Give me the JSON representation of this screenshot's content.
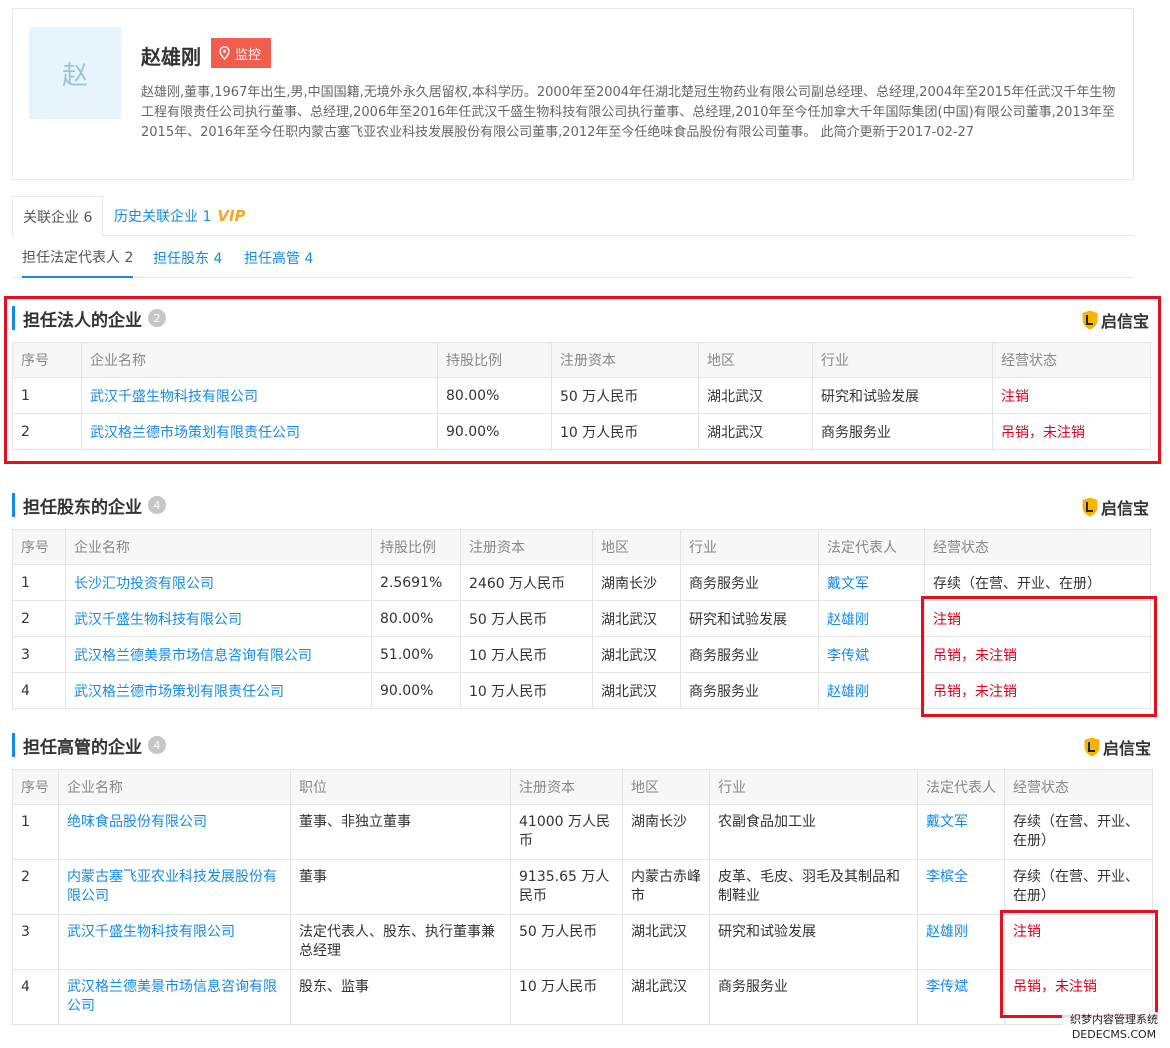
{
  "profile": {
    "avatar_char": "赵",
    "name": "赵雄刚",
    "monitor_label": "监控",
    "bio": "赵雄刚,董事,1967年出生,男,中国国籍,无境外永久居留权,本科学历。2000年至2004年任湖北楚冠生物药业有限公司副总经理、总经理,2004年至2015年任武汉千年生物工程有限责任公司执行董事、总经理,2006年至2016年任武汉千盛生物科技有限公司执行董事、总经理,2010年至今任加拿大千年国际集团(中国)有限公司董事,2013年至2015年、2016年至今任职内蒙古塞飞亚农业科技发展股份有限公司董事,2012年至今任绝味食品股份有限公司董事。 此简介更新于2017-02-27"
  },
  "tabs": {
    "related": "关联企业 6",
    "history": "历史关联企业 1",
    "vip": "VIP"
  },
  "subtabs": [
    "担任法定代表人 2",
    "担任股东 4",
    "担任高管 4"
  ],
  "brand": "启信宝",
  "legal": {
    "title": "担任法人的企业",
    "count": "2",
    "headers": [
      "序号",
      "企业名称",
      "持股比例",
      "注册资本",
      "地区",
      "行业",
      "经营状态"
    ],
    "rows": [
      [
        "1",
        "武汉千盛生物科技有限公司",
        "80.00%",
        "50 万人民币",
        "湖北武汉",
        "研究和试验发展",
        "注销"
      ],
      [
        "2",
        "武汉格兰德市场策划有限责任公司",
        "90.00%",
        "10 万人民币",
        "湖北武汉",
        "商务服务业",
        "吊销，未注销"
      ]
    ]
  },
  "shareholder": {
    "title": "担任股东的企业",
    "count": "4",
    "headers": [
      "序号",
      "企业名称",
      "持股比例",
      "注册资本",
      "地区",
      "行业",
      "法定代表人",
      "经营状态"
    ],
    "rows": [
      [
        "1",
        "长沙汇功投资有限公司",
        "2.5691%",
        "2460 万人民币",
        "湖南长沙",
        "商务服务业",
        "戴文军",
        "存续（在营、开业、在册）"
      ],
      [
        "2",
        "武汉千盛生物科技有限公司",
        "80.00%",
        "50 万人民币",
        "湖北武汉",
        "研究和试验发展",
        "赵雄刚",
        "注销"
      ],
      [
        "3",
        "武汉格兰德美景市场信息咨询有限公司",
        "51.00%",
        "10 万人民币",
        "湖北武汉",
        "商务服务业",
        "李传斌",
        "吊销，未注销"
      ],
      [
        "4",
        "武汉格兰德市场策划有限责任公司",
        "90.00%",
        "10 万人民币",
        "湖北武汉",
        "商务服务业",
        "赵雄刚",
        "吊销，未注销"
      ]
    ]
  },
  "executive": {
    "title": "担任高管的企业",
    "count": "4",
    "headers": [
      "序号",
      "企业名称",
      "职位",
      "注册资本",
      "地区",
      "行业",
      "法定代表人",
      "经营状态"
    ],
    "rows": [
      [
        "1",
        "绝味食品股份有限公司",
        "董事、非独立董事",
        "41000 万人民币",
        "湖南长沙",
        "农副食品加工业",
        "戴文军",
        "存续（在营、开业、在册）"
      ],
      [
        "2",
        "内蒙古塞飞亚农业科技发展股份有限公司",
        "董事",
        "9135.65 万人民币",
        "内蒙古赤峰市",
        "皮革、毛皮、羽毛及其制品和制鞋业",
        "李槟全",
        "存续（在营、开业、在册）"
      ],
      [
        "3",
        "武汉千盛生物科技有限公司",
        "法定代表人、股东、执行董事兼总经理",
        "50 万人民币",
        "湖北武汉",
        "研究和试验发展",
        "赵雄刚",
        "注销"
      ],
      [
        "4",
        "武汉格兰德美景市场信息咨询有限公司",
        "股东、监事",
        "10 万人民币",
        "湖北武汉",
        "商务服务业",
        "李传斌",
        "吊销，未注销"
      ]
    ]
  },
  "watermark": [
    "织梦内容管理系统",
    "DEDECMS.COM"
  ],
  "colors": {
    "link": "#128bed",
    "status_red": "#e3001b",
    "highlight_box": "#e5101e",
    "monitor_bg": "#f45c4b"
  }
}
